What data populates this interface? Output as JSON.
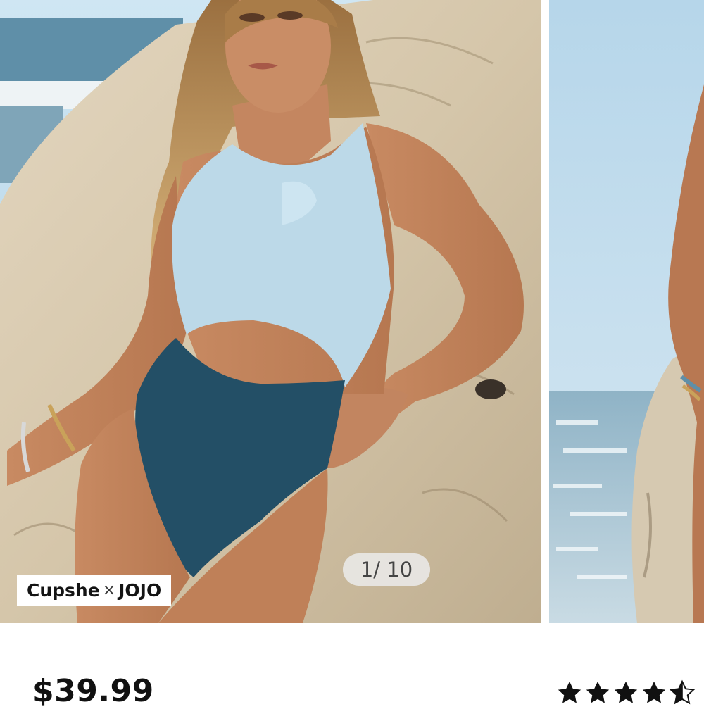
{
  "product": {
    "brand_name": "Cupshe",
    "brand_separator": "×",
    "brand_collab": "JOJO",
    "price": "$39.99",
    "rating": 4.5,
    "rating_max": 5
  },
  "gallery": {
    "counter": "1/ 10",
    "current_slide": 1,
    "total_slides": 10,
    "slides": [
      {
        "id": "slide-1",
        "description": "model-in-two-tone-cutout-swimsuit"
      },
      {
        "id": "slide-2",
        "description": "model-side-view-ocean"
      }
    ]
  },
  "colors": {
    "top_light_blue": "#bcd9e8",
    "bottom_navy": "#234f66",
    "sky": "#c7e2f1",
    "star": "#111111"
  },
  "icons": {
    "star_full": "star-icon",
    "star_half": "star-half-icon"
  }
}
